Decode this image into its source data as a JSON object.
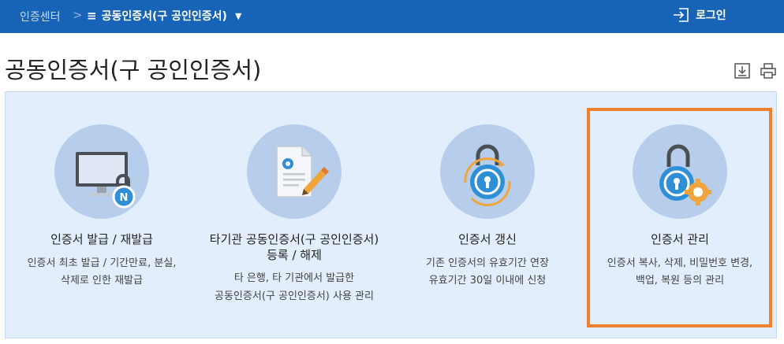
{
  "nav": {
    "home": "인증센터",
    "separator": ">",
    "current": "공동인증서(구 공인인증서)",
    "login": "로그인"
  },
  "page": {
    "title": "공동인증서(구 공인인증서)"
  },
  "cards": [
    {
      "title": "인증서 발급 / 재발급",
      "desc1": "인증서 최초 발급 / 기간만료, 분실,",
      "desc2": "삭제로 인한 재발급",
      "icon": "monitor-lock-icon"
    },
    {
      "title1": "타기관 공동인증서(구 공인인증서)",
      "title2": "등록 / 해제",
      "desc1": "타 은행, 타 기관에서 발급한",
      "desc2": "공동인증서(구 공인인증서) 사용 관리",
      "icon": "document-pencil-icon"
    },
    {
      "title": "인증서 갱신",
      "desc1": "기존 인증서의 유효기간 연장",
      "desc2": "유효기간 30일 이내에 신청",
      "icon": "lock-refresh-icon"
    },
    {
      "title": "인증서 관리",
      "desc1": "인증서 복사, 삭제, 비밀번호 변경,",
      "desc2": "백업, 복원 등의 관리",
      "icon": "lock-gear-icon"
    }
  ],
  "colors": {
    "nav_bg": "#1663b8",
    "panel_bg": "#e3eefc",
    "icon_circle": "#b7cdec",
    "highlight": "#f0802d"
  }
}
